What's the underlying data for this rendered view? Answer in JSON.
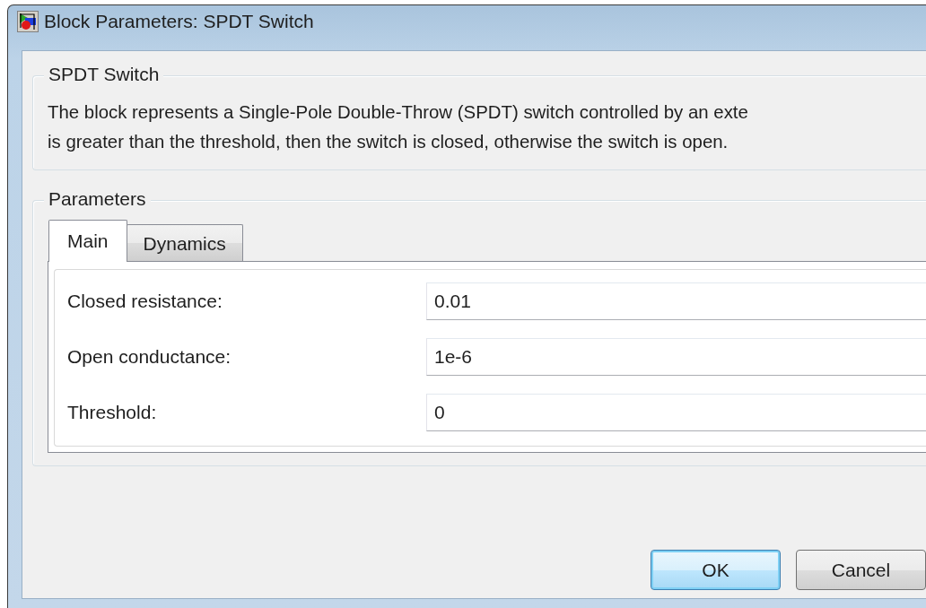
{
  "window": {
    "title": "Block Parameters: SPDT Switch"
  },
  "description_group": {
    "title": "SPDT Switch",
    "lines": [
      "The block represents a Single-Pole Double-Throw (SPDT) switch controlled by an exte",
      "is greater than the threshold, then the switch is closed, otherwise the switch is open."
    ]
  },
  "parameters_group": {
    "title": "Parameters",
    "tabs": [
      {
        "label": "Main",
        "selected": true
      },
      {
        "label": "Dynamics",
        "selected": false
      }
    ],
    "fields": [
      {
        "label": "Closed resistance:",
        "value": "0.01"
      },
      {
        "label": "Open conductance:",
        "value": "1e-6"
      },
      {
        "label": "Threshold:",
        "value": "0"
      }
    ]
  },
  "buttons": [
    {
      "label": "OK",
      "default": true
    },
    {
      "label": "Cancel",
      "default": false
    }
  ]
}
